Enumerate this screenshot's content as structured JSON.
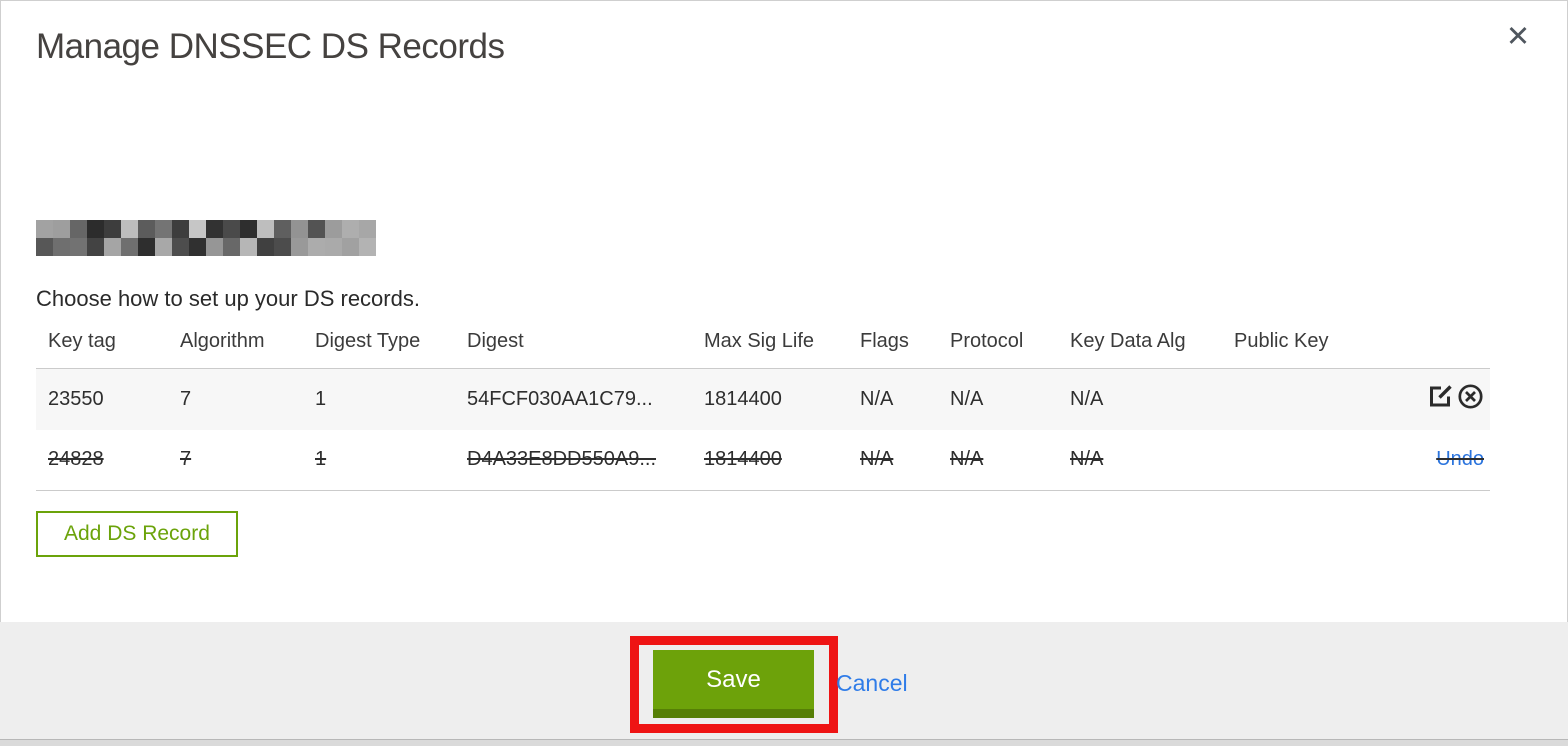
{
  "modal": {
    "title": "Manage DNSSEC DS Records",
    "close_glyph": "✕",
    "description": "Choose how to set up your DS records.",
    "add_button_label": "Add DS Record",
    "save_label": "Save",
    "cancel_label": "Cancel",
    "undo_label": "Undo"
  },
  "table": {
    "headers": [
      "Key tag",
      "Algorithm",
      "Digest Type",
      "Digest",
      "Max Sig Life",
      "Flags",
      "Protocol",
      "Key Data Alg",
      "Public Key"
    ],
    "rows": [
      {
        "key_tag": "23550",
        "algorithm": "7",
        "digest_type": "1",
        "digest": "54FCF030AA1C79...",
        "max_sig_life": "1814400",
        "flags": "N/A",
        "protocol": "N/A",
        "key_data_alg": "N/A",
        "public_key": "",
        "state": "normal"
      },
      {
        "key_tag": "24828",
        "algorithm": "7",
        "digest_type": "1",
        "digest": "D4A33E8DD550A9...",
        "max_sig_life": "1814400",
        "flags": "N/A",
        "protocol": "N/A",
        "key_data_alg": "N/A",
        "public_key": "",
        "state": "deleted"
      }
    ]
  },
  "icons": {
    "close": "close-icon",
    "edit": "edit-pencil-square-icon",
    "delete": "delete-circle-x-icon"
  },
  "colors": {
    "accent_green": "#6da20a",
    "accent_green_dark": "#567f06",
    "outline_green": "#6ba30a",
    "link_blue": "#2f7ce8",
    "undo_blue": "#2b74dd",
    "annotation_red": "#ee1414",
    "row_shade": "#f7f7f7",
    "footer_bg": "#eeeeee",
    "title_text": "#454240",
    "body_text": "#2e2e2e"
  }
}
